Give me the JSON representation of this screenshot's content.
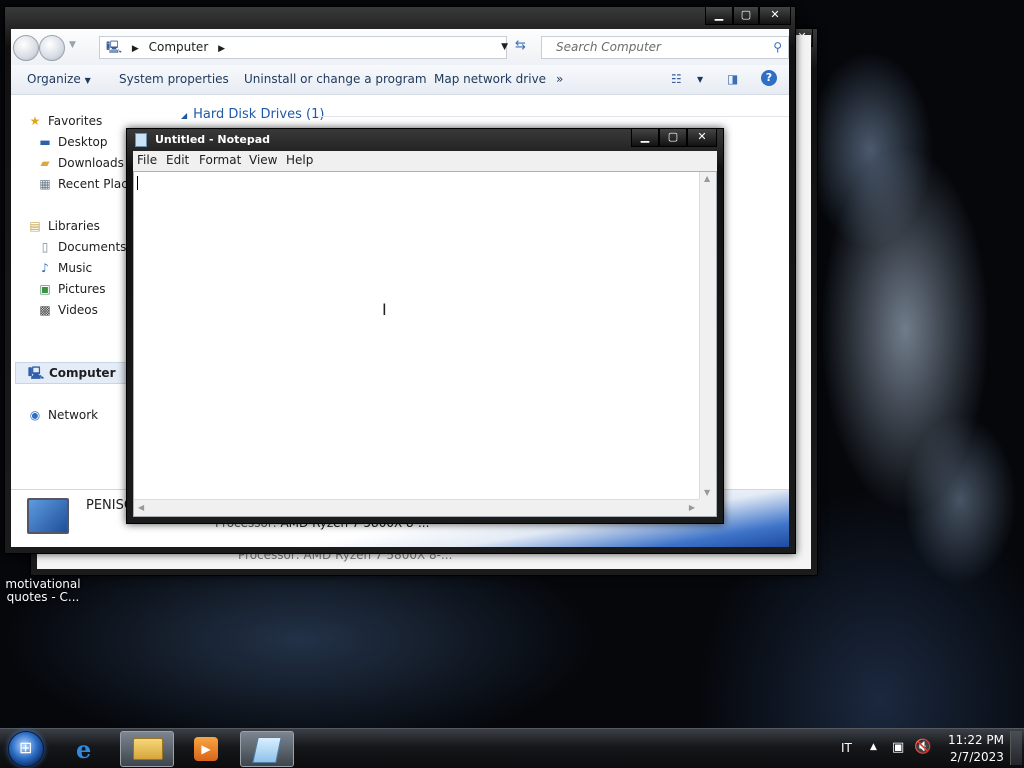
{
  "desktop": {
    "icon_label": "motivational quotes - C..."
  },
  "back_window": {
    "processor_label": "Processor:",
    "processor_value": "AMD Ryzen 7 5800X 8-..."
  },
  "explorer": {
    "breadcrumb": "Computer",
    "search_placeholder": "Search Computer",
    "commands": {
      "organize": "Organize",
      "system_properties": "System properties",
      "uninstall": "Uninstall or change a program",
      "map_drive": "Map network drive",
      "more": "»"
    },
    "nav": {
      "favorites": "Favorites",
      "desktop": "Desktop",
      "downloads": "Downloads",
      "recent": "Recent Places",
      "libraries": "Libraries",
      "documents": "Documents",
      "music": "Music",
      "pictures": "Pictures",
      "videos": "Videos",
      "computer": "Computer",
      "network": "Network"
    },
    "group_header": "Hard Disk Drives (1)",
    "details": {
      "computer_name": "PENISC",
      "processor_label": "Processor:",
      "processor_value": "AMD Ryzen 7 5800X 8-..."
    }
  },
  "notepad": {
    "title": "Untitled - Notepad",
    "menu": [
      "File",
      "Edit",
      "Format",
      "View",
      "Help"
    ],
    "content": ""
  },
  "taskbar": {
    "language": "IT",
    "time": "11:22 PM",
    "date": "2/7/2023"
  },
  "colors": {
    "link_blue": "#1e395b",
    "group_header_blue": "#1e5aa8",
    "taskbar_dark": "#15171a"
  }
}
